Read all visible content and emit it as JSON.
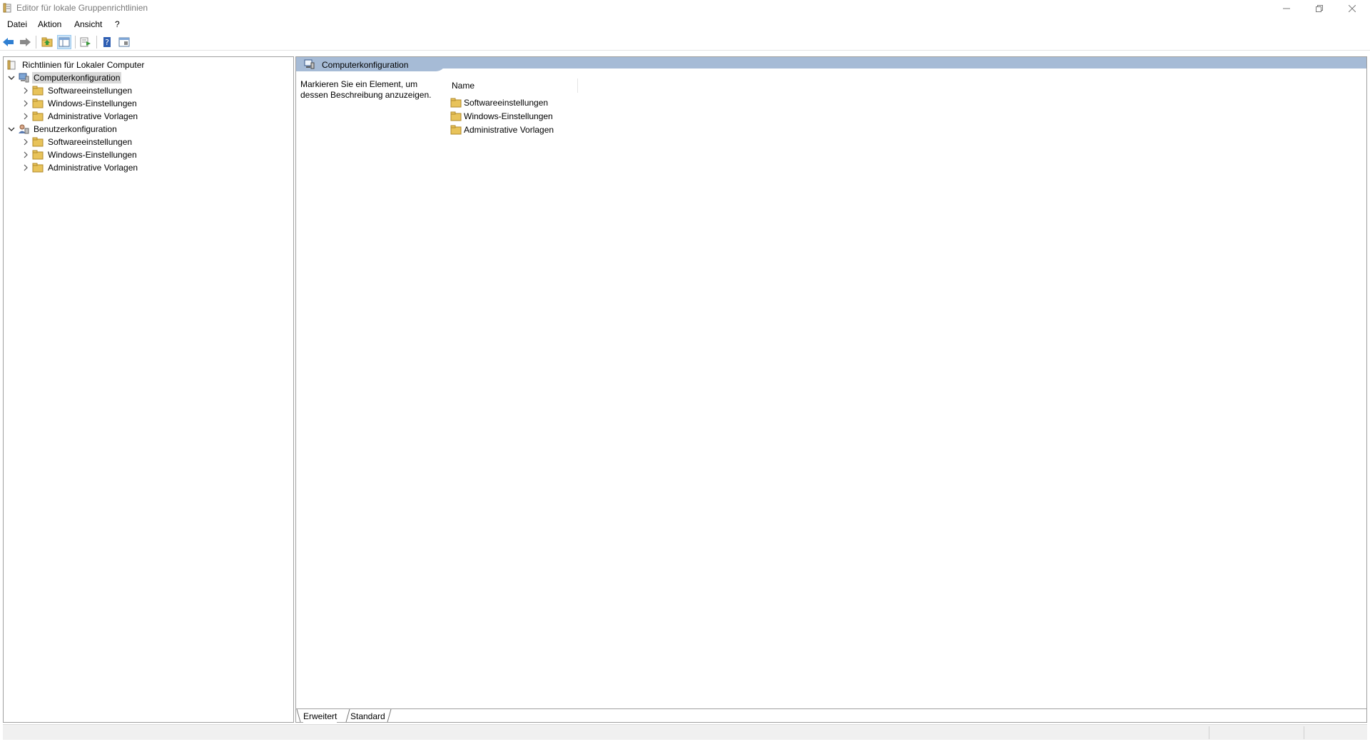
{
  "window": {
    "title": "Editor für lokale Gruppenrichtlinien"
  },
  "menu": {
    "items": [
      "Datei",
      "Aktion",
      "Ansicht",
      "?"
    ]
  },
  "toolbar": {
    "buttons": [
      "back-arrow-icon",
      "forward-arrow-icon",
      "up-folder-icon",
      "show-hide-tree-icon",
      "export-list-icon",
      "help-icon",
      "properties-icon"
    ]
  },
  "tree": {
    "root": "Richtlinien für Lokaler Computer",
    "computer": {
      "label": "Computerkonfiguration",
      "children": [
        "Softwareeinstellungen",
        "Windows-Einstellungen",
        "Administrative Vorlagen"
      ]
    },
    "user": {
      "label": "Benutzerkonfiguration",
      "children": [
        "Softwareeinstellungen",
        "Windows-Einstellungen",
        "Administrative Vorlagen"
      ]
    }
  },
  "content": {
    "header_title": "Computerkonfiguration",
    "description": "Markieren Sie ein Element, um dessen Beschreibung anzuzeigen.",
    "column_name": "Name",
    "items": [
      "Softwareeinstellungen",
      "Windows-Einstellungen",
      "Administrative Vorlagen"
    ]
  },
  "tabs": {
    "extended": "Erweitert",
    "standard": "Standard"
  },
  "colors": {
    "header_band": "#a6bbd6",
    "selection": "#d9d9d9",
    "folder": "#e8c35a"
  }
}
